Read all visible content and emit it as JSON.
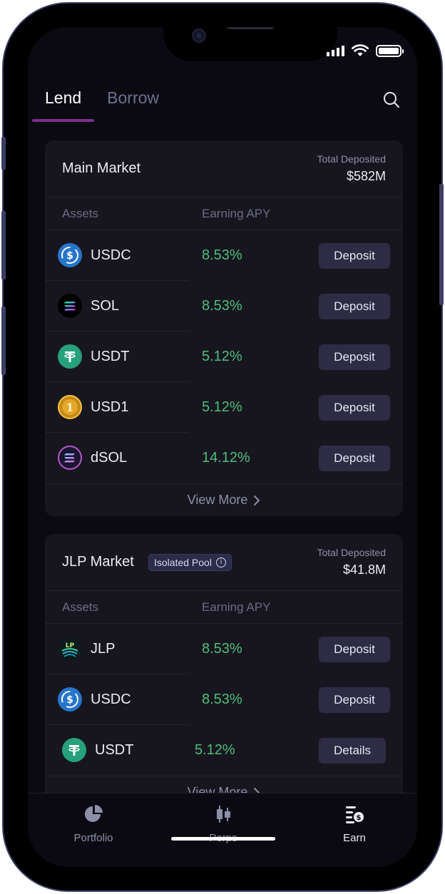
{
  "tabs": [
    {
      "label": "Lend",
      "active": true
    },
    {
      "label": "Borrow",
      "active": false
    }
  ],
  "main_market": {
    "title": "Main Market",
    "total_label": "Total Deposited",
    "total_value": "$582M",
    "col_assets": "Assets",
    "col_apy": "Earning APY",
    "rows": [
      {
        "asset": "USDC",
        "icon": "usdc-icon",
        "apy": "8.53%",
        "action": "Deposit"
      },
      {
        "asset": "SOL",
        "icon": "sol-icon",
        "apy": "8.53%",
        "action": "Deposit"
      },
      {
        "asset": "USDT",
        "icon": "usdt-icon",
        "apy": "5.12%",
        "action": "Deposit"
      },
      {
        "asset": "USD1",
        "icon": "usd1-icon",
        "apy": "5.12%",
        "action": "Deposit"
      },
      {
        "asset": "dSOL",
        "icon": "dsol-icon",
        "apy": "14.12%",
        "action": "Deposit"
      }
    ],
    "view_more": "View More"
  },
  "jlp_market": {
    "title": "JLP Market",
    "badge": "Isolated Pool",
    "total_label": "Total Deposited",
    "total_value": "$41.8M",
    "col_assets": "Assets",
    "col_apy": "Earning APY",
    "rows": [
      {
        "asset": "JLP",
        "icon": "jlp-icon",
        "apy": "8.53%",
        "action": "Deposit"
      },
      {
        "asset": "USDC",
        "icon": "usdc-icon",
        "apy": "8.53%",
        "action": "Deposit"
      },
      {
        "asset": "USDT",
        "icon": "usdt-icon",
        "apy": "5.12%",
        "action": "Details"
      }
    ],
    "view_more": "View More"
  },
  "nav": [
    {
      "label": "Portfolio",
      "icon": "pie-chart-icon",
      "active": false
    },
    {
      "label": "Perps",
      "icon": "candlestick-icon",
      "active": false
    },
    {
      "label": "Earn",
      "icon": "earn-icon",
      "active": true
    }
  ],
  "colors": {
    "accent": "#7d2e8c",
    "positive": "#4ebe7a",
    "background": "#0b0a12",
    "card": "#17161f"
  }
}
